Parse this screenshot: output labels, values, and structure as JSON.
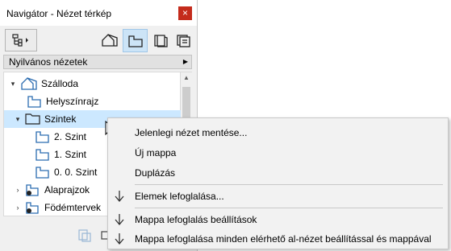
{
  "window": {
    "title": "Navigátor - Nézet térkép",
    "close_glyph": "×"
  },
  "toolbar": {
    "buttons": [
      {
        "icon": "project-map-icon"
      },
      {
        "icon": "view-map-icon",
        "selected": true
      },
      {
        "icon": "layout-book-icon"
      },
      {
        "icon": "publisher-sets-icon"
      }
    ]
  },
  "section": {
    "label": "Nyilvános nézetek",
    "arrow": "▶"
  },
  "tree": {
    "items": [
      {
        "label": "Szálloda",
        "expander": "▾",
        "icon": "building-icon",
        "level": 0
      },
      {
        "label": "Helyszínrajz",
        "expander": "",
        "icon": "floor-plan-icon",
        "level": 1
      },
      {
        "label": "Szintek",
        "expander": "▾",
        "icon": "folder-icon",
        "level": 1,
        "selected": true
      },
      {
        "label": "2. Szint",
        "expander": "",
        "icon": "floor-plan-icon",
        "level": 2
      },
      {
        "label": "1. Szint",
        "expander": "",
        "icon": "floor-plan-icon",
        "level": 2
      },
      {
        "label": "0. 0. Szint",
        "expander": "",
        "icon": "floor-plan-icon",
        "level": 2
      },
      {
        "label": "Alaprajzok",
        "expander": "›",
        "icon": "folder-settings-icon",
        "level": 1
      },
      {
        "label": "Födémtervek",
        "expander": "›",
        "icon": "folder-settings-icon",
        "level": 1
      }
    ]
  },
  "context_menu": {
    "items": [
      {
        "label": "Jelenlegi nézet mentése...",
        "icon": ""
      },
      {
        "label": "Új mappa",
        "icon": ""
      },
      {
        "label": "Duplázás",
        "icon": ""
      },
      {
        "label": "Elemek lefoglalása...",
        "icon": "down-arrow-icon"
      },
      {
        "label": "Mappa lefoglalás beállítások",
        "icon": "down-arrow-icon"
      },
      {
        "label": "Mappa lefoglalása minden elérhető al-nézet beállítással és mappával",
        "icon": "down-arrow-icon"
      }
    ]
  },
  "colors": {
    "selection": "#cce8ff",
    "close": "#c42b1c",
    "icon_blue": "#2b6cb0"
  }
}
